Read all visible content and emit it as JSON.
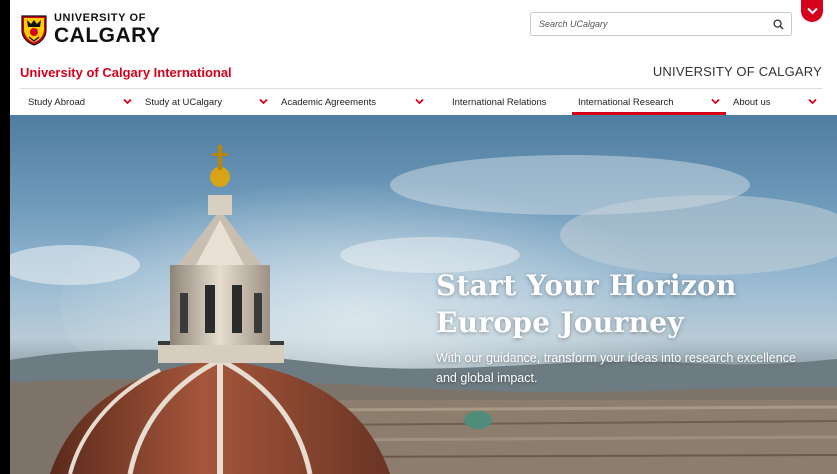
{
  "logo": {
    "line1": "UNIVERSITY OF",
    "line2": "CALGARY"
  },
  "search": {
    "placeholder": "Search UCalgary"
  },
  "header": {
    "site_title": "University of Calgary International",
    "uc_link": "UNIVERSITY OF CALGARY"
  },
  "nav": {
    "items": [
      {
        "label": "Study Abroad",
        "has_dropdown": true,
        "active": false
      },
      {
        "label": "Study at UCalgary",
        "has_dropdown": true,
        "active": false
      },
      {
        "label": "Academic Agreements",
        "has_dropdown": true,
        "active": false
      },
      {
        "label": "International Relations",
        "has_dropdown": false,
        "active": false
      },
      {
        "label": "International Research",
        "has_dropdown": true,
        "active": true
      },
      {
        "label": "About us",
        "has_dropdown": true,
        "active": false
      }
    ]
  },
  "hero": {
    "title_line1": "Start Your Horizon",
    "title_line2": "Europe Journey",
    "subtitle": "With our guidance, transform your ideas into research excellence and global impact."
  },
  "colors": {
    "brand_red": "#d6001c",
    "brand_gold": "#ffcd00"
  },
  "icons": {
    "search": "search-icon",
    "menu_toggle": "chevron-down-icon",
    "dropdown": "chevron-down-icon",
    "crest": "crest-icon"
  }
}
